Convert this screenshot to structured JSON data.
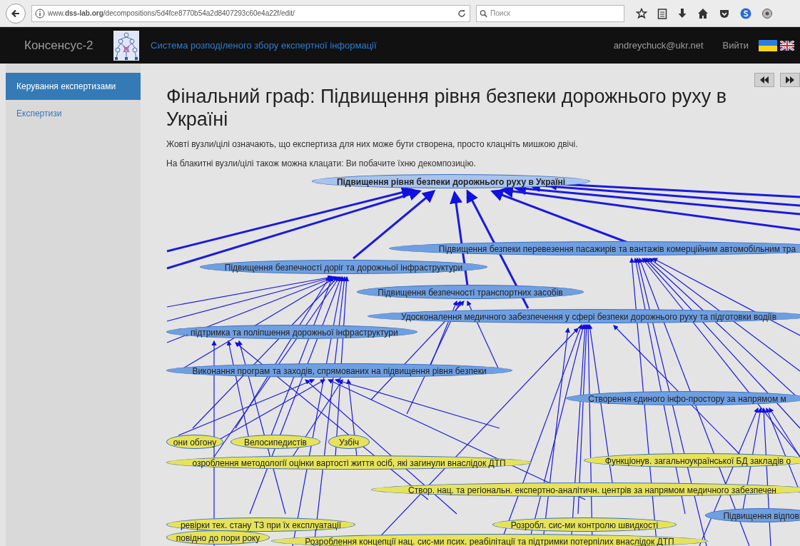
{
  "browser": {
    "url": "www.**dss-lab.org**/decompositions/5d4fce8770b54a2d8407293c60e4a22f/edit/",
    "search_placeholder": "Поиск"
  },
  "navbar": {
    "brand": "Консенсус-2",
    "subtitle": "Система розподіленого збору експертної інформації",
    "user": "andreychuck@ukr.net",
    "logout": "Вийти"
  },
  "sidebar": {
    "items": [
      {
        "label": "Керування експертизами",
        "selected": true
      },
      {
        "label": "Експертизи",
        "selected": false
      }
    ]
  },
  "page": {
    "title": "Фінальний граф: Підвищення рівня безпеки дорожнього руху в Україні",
    "notes": [
      "Жовті вузли/цілі означають, що експертиза для них може бути створена, просто клацніть мишкою двічі.",
      "На блакитні вузли/цілі також можна клацати: Ви побачите їхню декомпозицію."
    ]
  },
  "graph": {
    "nodes": [
      {
        "label": "Підвищення рівня безпеки дорожнього руху в Україні",
        "color": "#a9c4ec",
        "bold": true
      },
      {
        "label": "Підвищення безпеки перевезення пасажирів та вантажів комерційним автомобільним тра",
        "color": "#6f9fe0",
        "bold": false
      },
      {
        "label": "Підвищення безпечності доріг та дорожньої інфраструктури",
        "color": "#6f9fe0",
        "bold": false
      },
      {
        "label": "Підвищення безпечності транспортних засобів",
        "color": "#6f9fe0",
        "bold": false
      },
      {
        "label": "Удосконалення медичного забезпечення у сфері безпеки дорожнього руху та підготовки водіїв",
        "color": "#6f9fe0",
        "bold": false
      },
      {
        "label": ", підтримка та поліпшення дорожньої інфраструктури",
        "color": "#6f9fe0",
        "bold": false
      },
      {
        "label": "Виконання програм та заходів, спрямованих на підвищення рівня безпеки",
        "color": "#6f9fe0",
        "bold": false
      },
      {
        "label": "Створення єдиного інфо-простору за напрямом м",
        "color": "#6f9fe0",
        "bold": false
      },
      {
        "label": "они обгону",
        "color": "#e6e35a",
        "bold": false
      },
      {
        "label": "Велосипедистів",
        "color": "#e6e35a",
        "bold": false
      },
      {
        "label": "Узбіч",
        "color": "#e6e35a",
        "bold": false
      },
      {
        "label": "озроблення методології оцінки вартості життя осіб, які загинули внаслідок ДТП",
        "color": "#e6e35a",
        "bold": false
      },
      {
        "label": "Функціонув. загальноукраїнської БД закладів о",
        "color": "#e6e35a",
        "bold": false
      },
      {
        "label": "Створ. нац. та регіональн. експертно-аналітичн. центрів за напрямом медичного забезпечен",
        "color": "#e6e35a",
        "bold": false
      },
      {
        "label": "Підвищення відпові",
        "color": "#6f9fe0",
        "bold": false
      },
      {
        "label": "ревірки тех. стану ТЗ при їх експлуатації",
        "color": "#e6e35a",
        "bold": false
      },
      {
        "label": "Розробл. сис-ми контролю швидкості",
        "color": "#e6e35a",
        "bold": false
      },
      {
        "label": "повідно до пори року",
        "color": "#e6e35a",
        "bold": false
      },
      {
        "label": "Розроблення концепції нац. сис-ми псих. реабілітації та підтримки потерпілих внаслідок ДТП",
        "color": "#e6e35a",
        "bold": false
      }
    ]
  }
}
